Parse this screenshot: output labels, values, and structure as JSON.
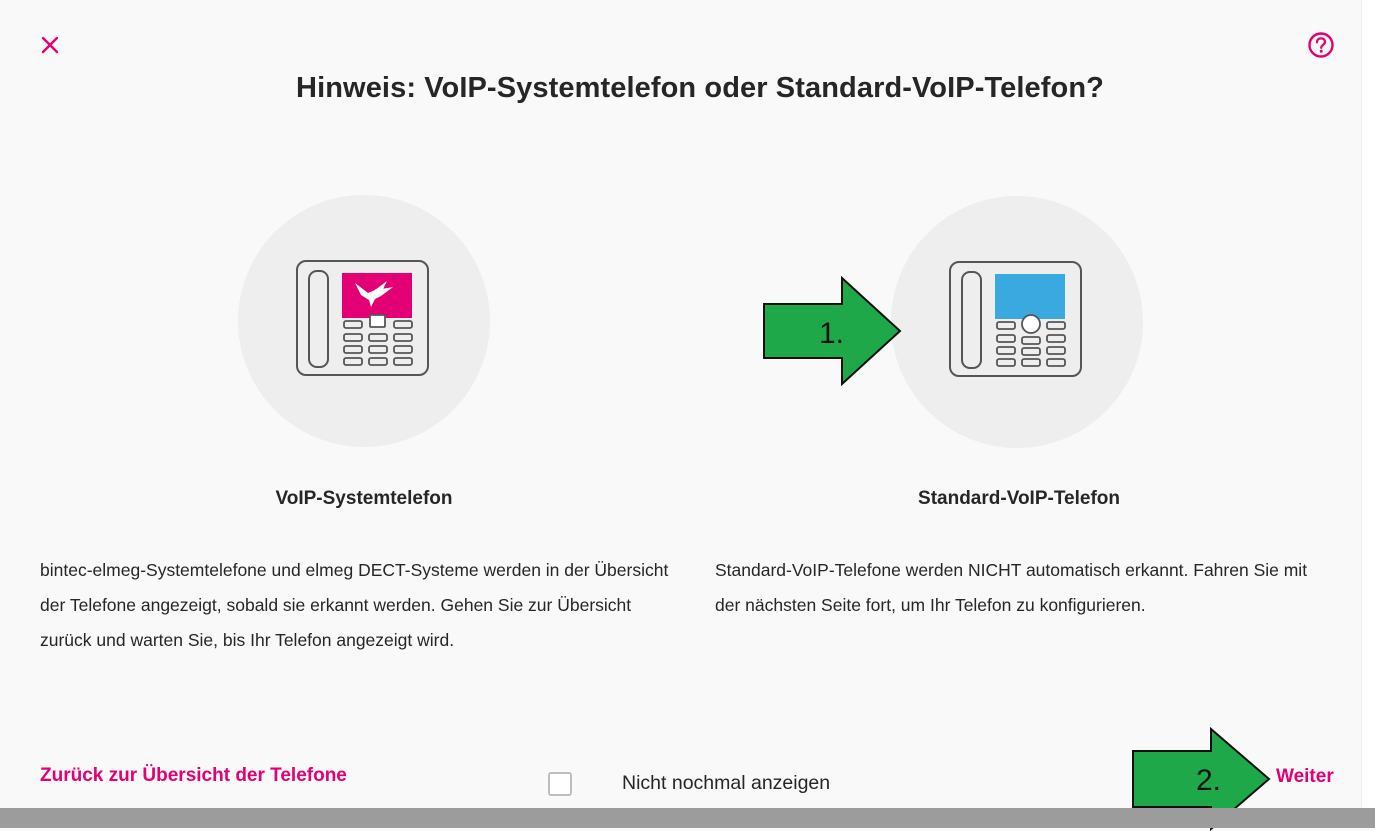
{
  "dialog": {
    "title": "Hinweis: VoIP-Systemtelefon oder Standard-VoIP-Telefon?",
    "close_icon": "close-icon",
    "help_icon": "help-icon"
  },
  "options": {
    "system": {
      "heading": "VoIP-Systemtelefon",
      "description": "bintec-elmeg-Systemtelefone und elmeg DECT-Systeme werden in der Übersicht der Telefone angezeigt, sobald sie erkannt werden. Gehen Sie zur Übersicht zurück und warten Sie, bis Ihr Telefon angezeigt wird.",
      "icon": "system-phone-icon",
      "screen_color": "#e20074"
    },
    "standard": {
      "heading": "Standard-VoIP-Telefon",
      "description": "Standard-VoIP-Telefone werden NICHT automatisch erkannt. Fahren Sie mit der nächsten Seite fort, um Ihr Telefon zu konfigurieren.",
      "icon": "standard-phone-icon",
      "screen_color": "#3aa9e0"
    }
  },
  "footer": {
    "back_label": "Zurück zur Übersicht der Telefone",
    "dont_show_label": "Nicht nochmal anzeigen",
    "dont_show_checked": false,
    "next_label": "Weiter"
  },
  "annotations": [
    {
      "label": "1."
    },
    {
      "label": "2."
    }
  ],
  "colors": {
    "accent": "#e20074",
    "arrow_fill": "#1fa84a",
    "circle_bg": "#eeeeee"
  }
}
